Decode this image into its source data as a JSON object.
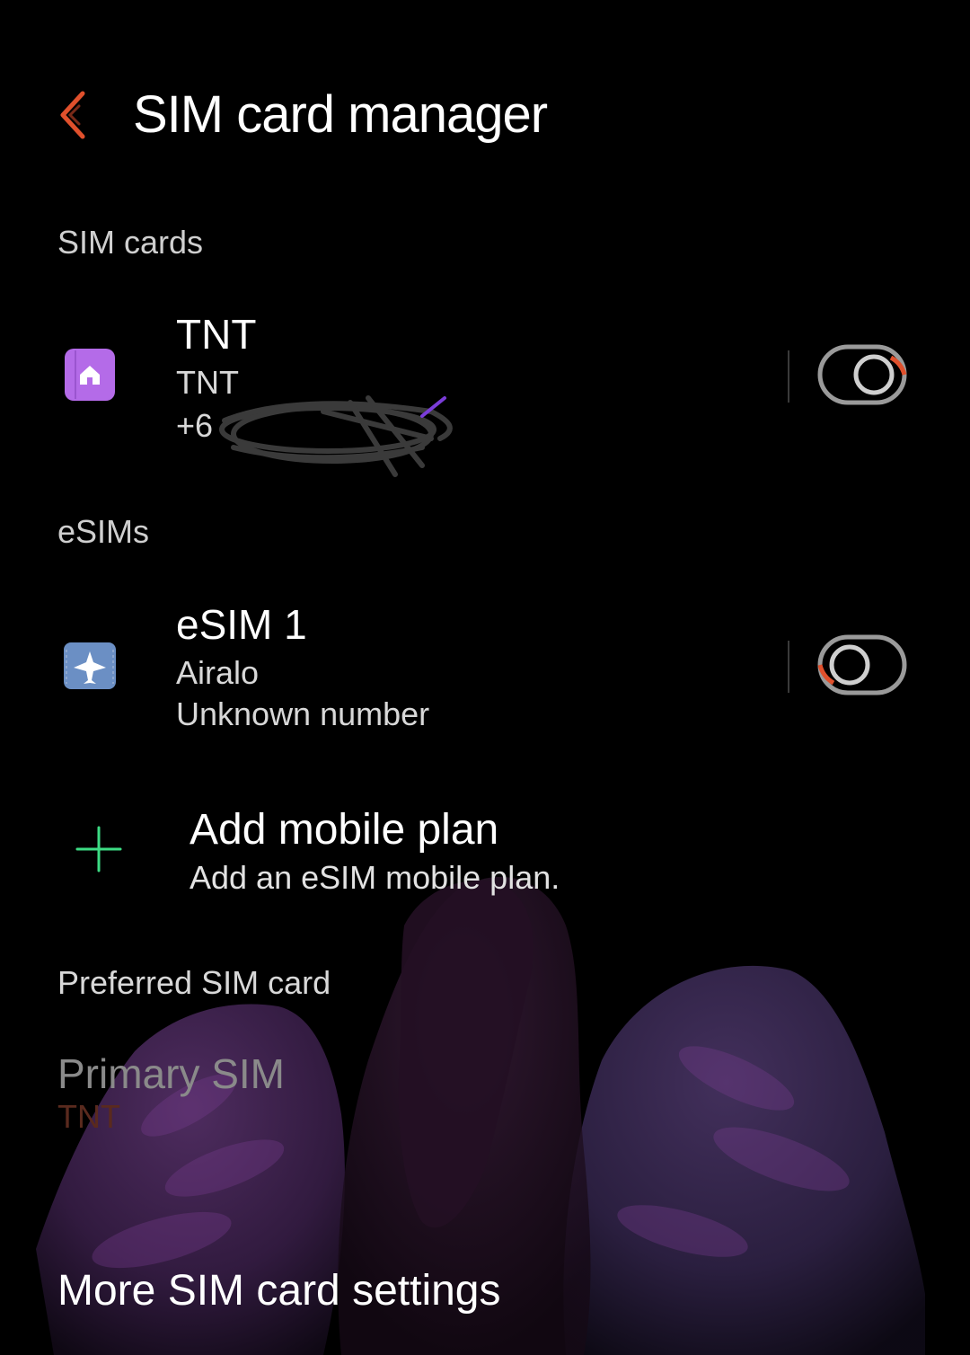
{
  "header": {
    "title": "SIM card manager",
    "back_icon": "back-chevron-icon"
  },
  "sections": {
    "sim_cards": "SIM cards",
    "esims": "eSIMs",
    "preferred": "Preferred SIM card"
  },
  "sim_card": {
    "name": "TNT",
    "carrier": "TNT",
    "number_visible": "+6",
    "icon": "home-icon",
    "icon_color": "#b46be8",
    "enabled": true
  },
  "esim": {
    "name": "eSIM 1",
    "carrier": "Airalo",
    "number": "Unknown number",
    "icon": "airplane-icon",
    "icon_color": "#6b8fc4",
    "enabled": false
  },
  "add_plan": {
    "title": "Add mobile plan",
    "subtitle": "Add an eSIM mobile plan.",
    "icon": "plus-icon",
    "icon_color": "#3ddc84"
  },
  "preferred": {
    "primary_label": "Primary SIM",
    "primary_value": "TNT"
  },
  "more_settings": "More SIM card settings",
  "colors": {
    "accent": "#e0502c",
    "background": "#000000"
  }
}
